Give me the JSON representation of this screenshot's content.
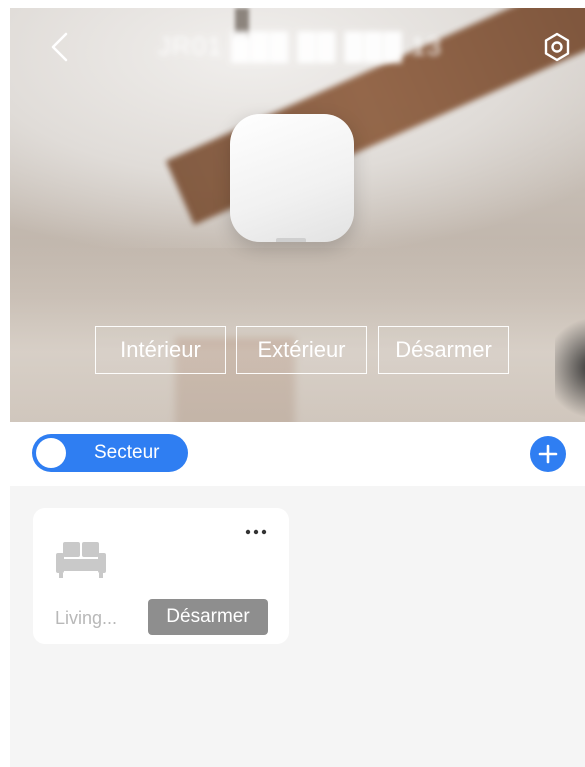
{
  "header": {
    "title": "JR01 ███ ██ ███ 13"
  },
  "icons": {
    "back": "chevron-left-icon",
    "settings": "settings-icon",
    "add": "plus-icon",
    "more": "more-horizontal-icon",
    "room": "sofa-icon"
  },
  "modes": [
    {
      "label": "Intérieur"
    },
    {
      "label": "Extérieur"
    },
    {
      "label": "Désarmer"
    }
  ],
  "toolbar": {
    "toggle_label": "Secteur"
  },
  "rooms": [
    {
      "name": "Living...",
      "status": "Désarmer"
    }
  ],
  "colors": {
    "accent": "#2f7ef2",
    "status_badge": "#8e8e8e",
    "content_bg": "#f5f5f5"
  }
}
